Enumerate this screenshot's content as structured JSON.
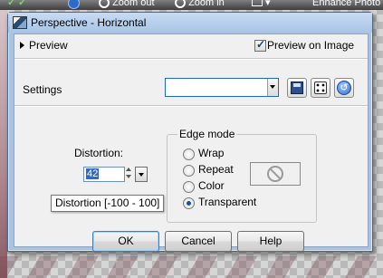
{
  "app_toolbar": {
    "zoom_out_label": "Zoom out",
    "zoom_in_label": "Zoom in",
    "enhance_photo_label": "Enhance Photo"
  },
  "dialog": {
    "title": "Perspective - Horizontal",
    "preview": {
      "label": "Preview",
      "preview_on_image_label": "Preview on Image",
      "preview_on_image_checked": true
    },
    "settings": {
      "label": "Settings",
      "selected_value": "",
      "buttons": [
        "save-preset-icon",
        "randomize-icon",
        "reset-icon"
      ]
    },
    "distortion": {
      "label": "Distortion:",
      "value": "42",
      "tooltip": "Distortion [-100 - 100]"
    },
    "edge_mode": {
      "legend": "Edge mode",
      "options": [
        "Wrap",
        "Repeat",
        "Color",
        "Transparent"
      ],
      "selected": "Transparent",
      "color_swatch_icon": "no-color-icon"
    },
    "buttons": {
      "ok": "OK",
      "cancel": "Cancel",
      "help": "Help"
    }
  },
  "colors": {
    "title_bar": "#a9c4e6",
    "client_bg": "#f0f0f0",
    "selection": "#3169c6"
  }
}
